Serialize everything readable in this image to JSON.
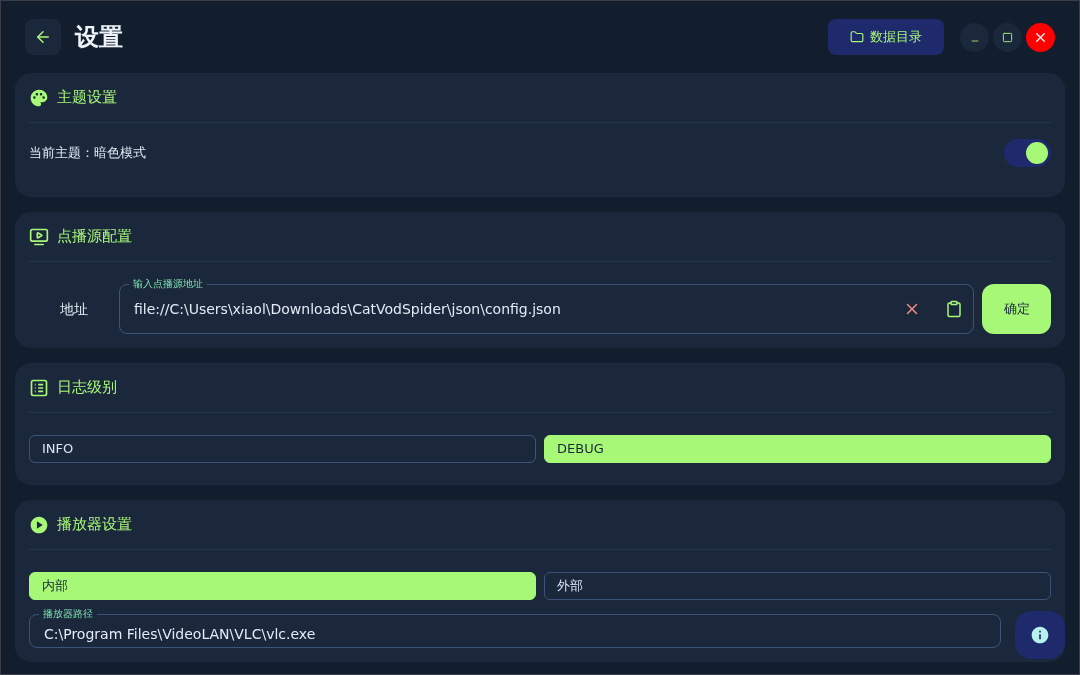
{
  "header": {
    "title": "设置",
    "data_dir_button": "数据目录"
  },
  "theme": {
    "title": "主题设置",
    "label": "当前主题：暗色模式",
    "on": true
  },
  "source": {
    "title": "点播源配置",
    "label": "地址",
    "field_label": "输入点播源地址",
    "value": "file://C:\\Users\\xiaol\\Downloads\\CatVodSpider\\json\\config.json",
    "confirm": "确定"
  },
  "log_level": {
    "title": "日志级别",
    "options": [
      {
        "label": "INFO",
        "selected": false
      },
      {
        "label": "DEBUG",
        "selected": true
      }
    ]
  },
  "player": {
    "title": "播放器设置",
    "options": [
      {
        "label": "内部",
        "selected": true
      },
      {
        "label": "外部",
        "selected": false
      }
    ],
    "path_label": "播放器路径",
    "path": "C:\\Program Files\\VideoLAN\\VLC\\vlc.exe"
  }
}
